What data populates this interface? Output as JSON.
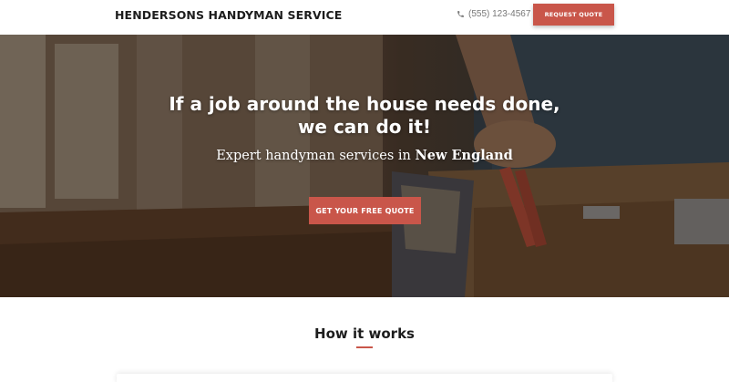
{
  "header": {
    "brand": "HENDERSONS HANDYMAN SERVICE",
    "phone_icon": "phone-icon",
    "phone": "(555) 123-4567",
    "request_button": "REQUEST QUOTE"
  },
  "hero": {
    "title_line1": "If a job around the house needs done,",
    "title_line2": "we can do it!",
    "subtitle_prefix": "Expert handyman services in ",
    "subtitle_region": "New England",
    "cta_button": "GET YOUR FREE QUOTE"
  },
  "how_it_works": {
    "title": "How it works"
  },
  "colors": {
    "accent": "#c9564a",
    "header_bg": "#ffffff",
    "text_dark": "#1d1d1d"
  }
}
